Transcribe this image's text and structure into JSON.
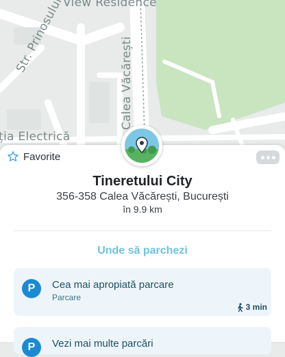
{
  "map": {
    "labels": {
      "residence": "View Residence",
      "street_prinosului": "Str. Prinosului",
      "street_vacaresti": "Calea Văcărești",
      "street_electrica": "ția Electrică"
    },
    "colors": {
      "background": "#e8ebe9",
      "road": "#ffffff",
      "park": "#c8e5c0"
    },
    "pin_icon": "location-pin-icon"
  },
  "place": {
    "favorite_label": "Favorite",
    "more_icon": "ellipsis-icon",
    "name": "Tineretului City",
    "address": "356-358 Calea Văcărești, București",
    "distance": "în 9.9 km"
  },
  "parking": {
    "section_title": "Unde să parchezi",
    "accent": "#6fc3dc",
    "items": [
      {
        "badge": "P",
        "title": "Cea mai apropiată parcare",
        "subtitle": "Parcare",
        "walk_time": "3 min"
      },
      {
        "badge": "P",
        "title": "Vezi mai multe parcări"
      }
    ]
  }
}
